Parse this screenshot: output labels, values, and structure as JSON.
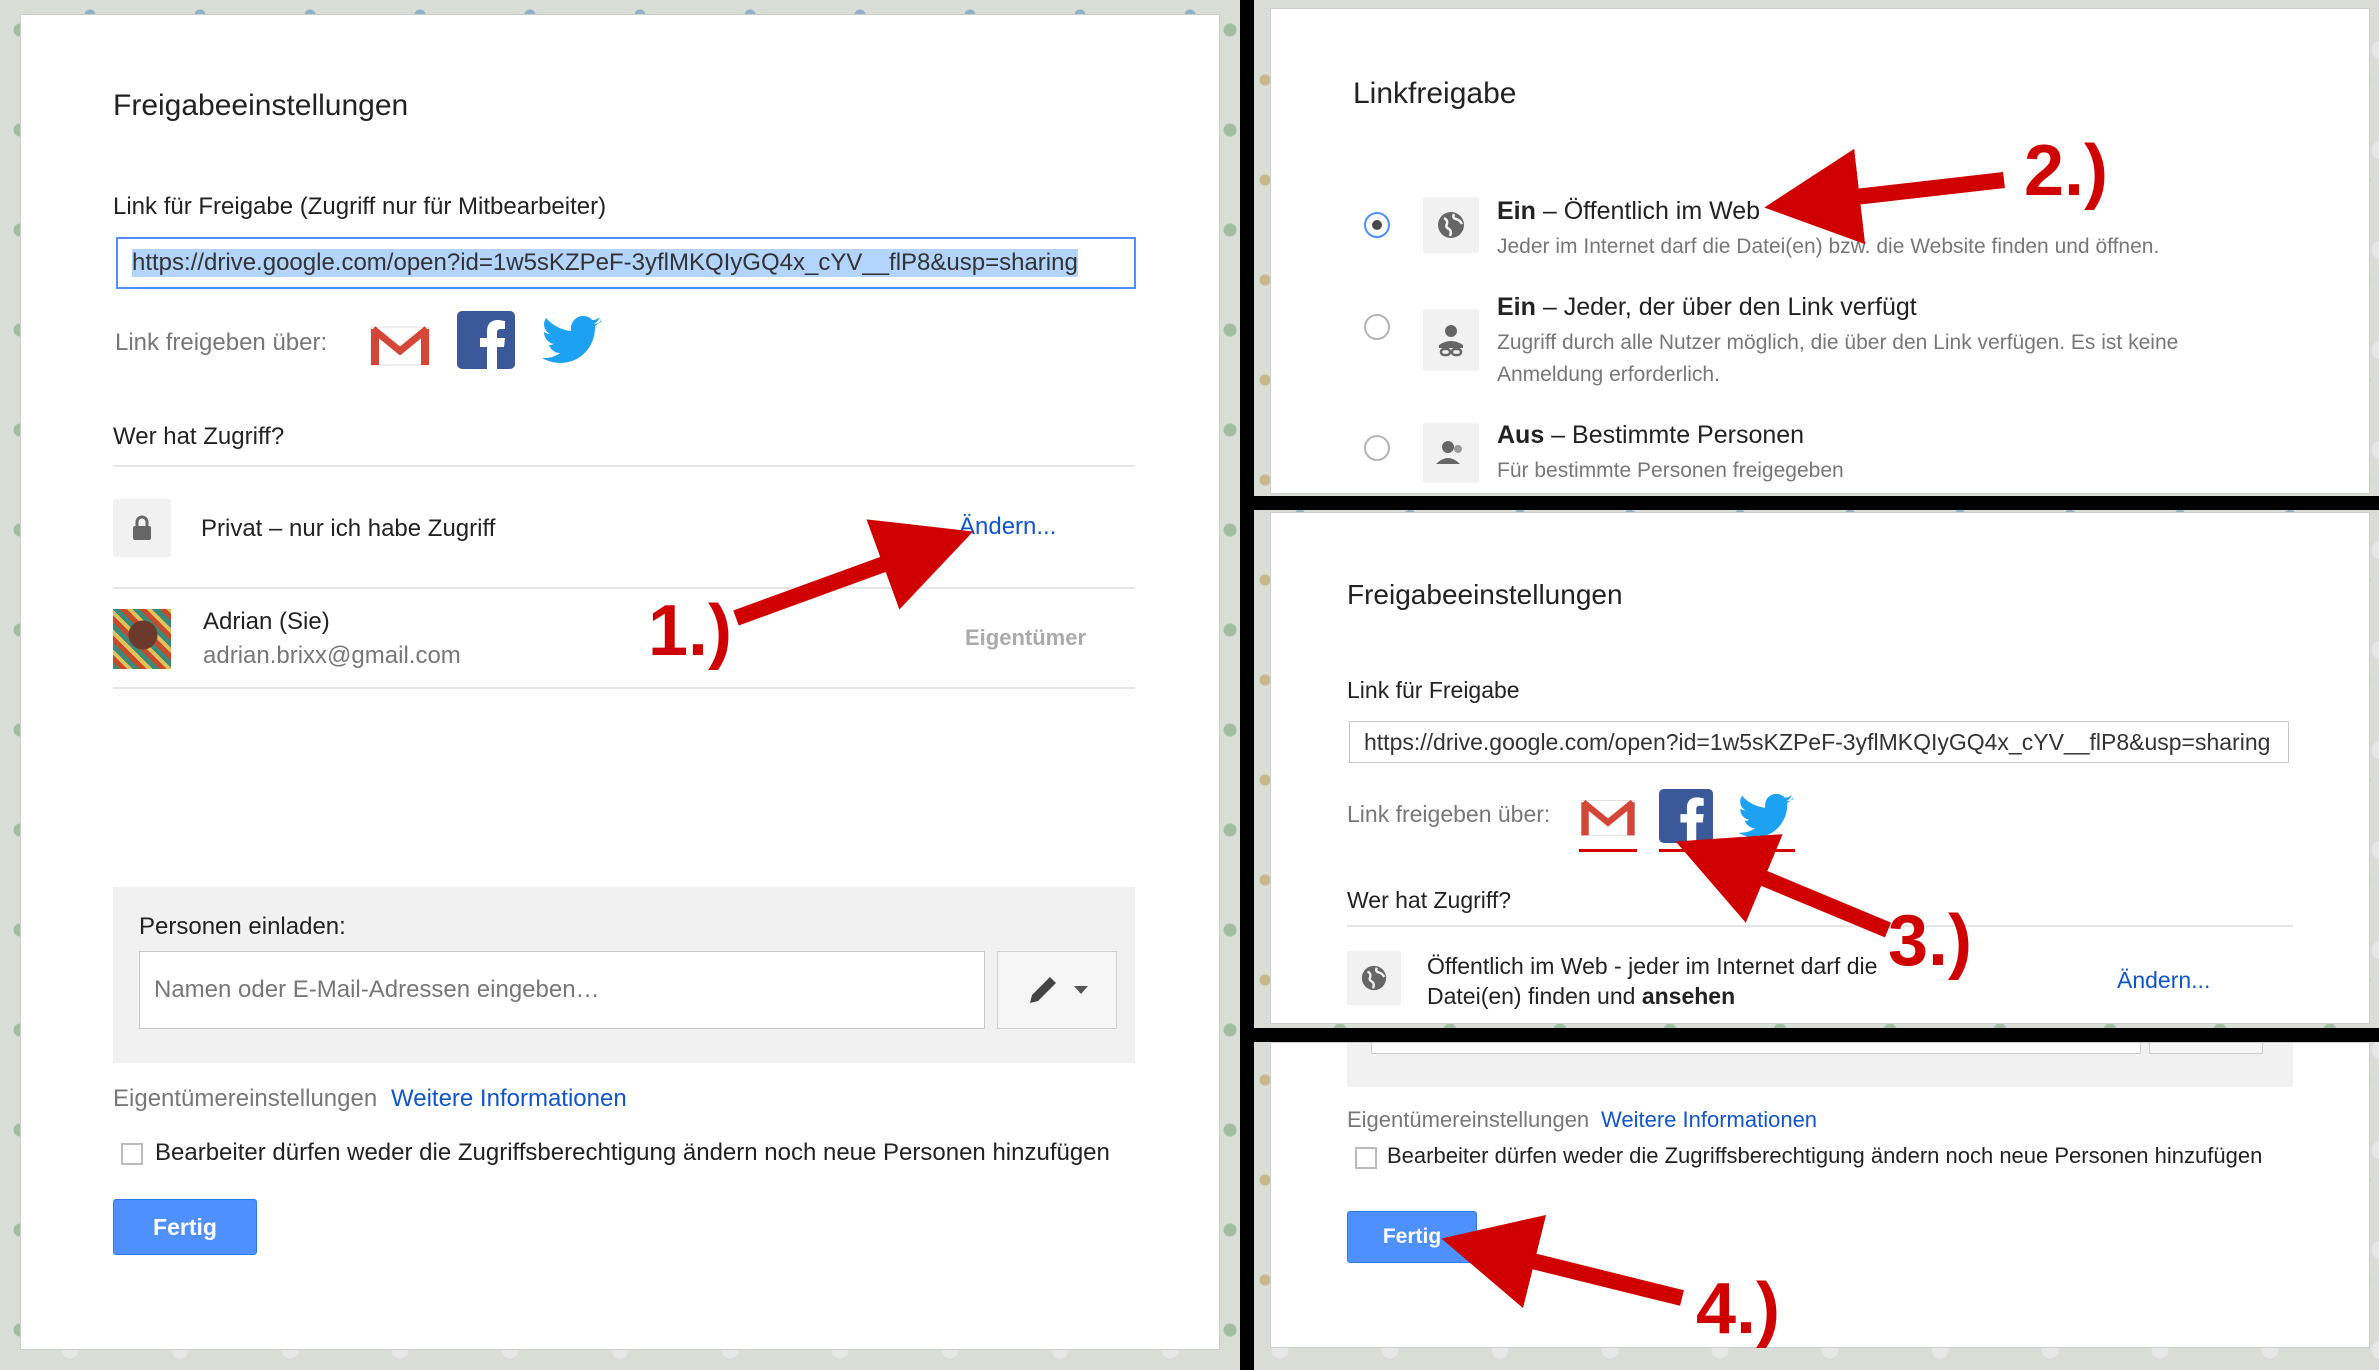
{
  "panel1": {
    "title": "Freigabeeinstellungen",
    "link_label": "Link für Freigabe (Zugriff nur für Mitbearbeiter)",
    "link_value": "https://drive.google.com/open?id=1w5sKZPeF-3yflMKQIyGQ4x_cYV__flP8&usp=sharing",
    "share_via_label": "Link freigeben über:",
    "share_icons": [
      "gmail-icon",
      "facebook-icon",
      "twitter-icon"
    ],
    "access_heading": "Wer hat Zugriff?",
    "access_row": {
      "text": "Privat – nur ich habe Zugriff",
      "change_link": "Ändern...",
      "icon": "lock-icon"
    },
    "owner": {
      "name": "Adrian (Sie)",
      "email": "adrian.brixx@gmail.com",
      "role": "Eigentümer"
    },
    "invite": {
      "label": "Personen einladen:",
      "placeholder": "Namen oder E-Mail-Adressen eingeben…",
      "icon": "pencil-icon"
    },
    "owner_settings": {
      "label": "Eigentümereinstellungen",
      "more_link": "Weitere Informationen",
      "checkbox_label": "Bearbeiter dürfen weder die Zugriffsberechtigung ändern noch neue Personen hinzufügen"
    },
    "done_button": "Fertig"
  },
  "panel2": {
    "title": "Linkfreigabe",
    "options": [
      {
        "bold": "Ein",
        "rest": " – Öffentlich im Web",
        "desc": "Jeder im Internet darf die Datei(en) bzw. die Website finden und öffnen.",
        "selected": true,
        "icon": "globe-icon"
      },
      {
        "bold": "Ein",
        "rest": " – Jeder, der über den Link verfügt",
        "desc1": "Zugriff durch alle Nutzer möglich, die über den Link verfügen. Es ist keine",
        "desc2": "Anmeldung erforderlich.",
        "selected": false,
        "icon": "link-person-icon"
      },
      {
        "bold": "Aus",
        "rest": " – Bestimmte Personen",
        "desc": "Für bestimmte Personen freigegeben",
        "selected": false,
        "icon": "people-icon"
      }
    ]
  },
  "panel3": {
    "title": "Freigabeeinstellungen",
    "link_label": "Link für Freigabe",
    "link_value": "https://drive.google.com/open?id=1w5sKZPeF-3yflMKQIyGQ4x_cYV__flP8&usp=sharing",
    "share_via_label": "Link freigeben über:",
    "access_heading": "Wer hat Zugriff?",
    "access_line1": "Öffentlich im Web - jeder im Internet darf die",
    "access_line2_pre": "Datei(en) finden und ",
    "access_line2_bold": "ansehen",
    "change_link": "Ändern..."
  },
  "panel4": {
    "owner_settings_label": "Eigentümereinstellungen",
    "more_link": "Weitere Informationen",
    "checkbox_label": "Bearbeiter dürfen weder die Zugriffsberechtigung ändern noch neue Personen hinzufügen",
    "done_button": "Fertig"
  },
  "annotations": {
    "step1": "1.)",
    "step2": "2.)",
    "step3": "3.)",
    "step4": "4.)"
  },
  "colors": {
    "accent_blue": "#4d90fe",
    "link_blue": "#1155cc",
    "annotation_red": "#d10000",
    "facebook": "#3b5998",
    "twitter": "#1da1f2",
    "gmail_red": "#d44638"
  }
}
